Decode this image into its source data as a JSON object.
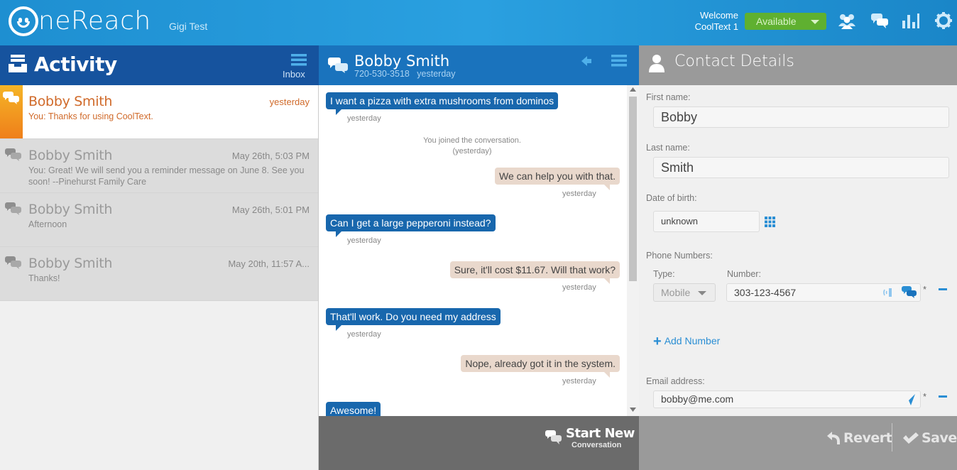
{
  "header": {
    "logo_text": "neReach",
    "account": "Gigi Test",
    "welcome_line1": "Welcome",
    "welcome_line2": "CoolText 1",
    "status": "Available",
    "icons": [
      "contacts-icon",
      "conversations-icon",
      "reports-icon",
      "settings-icon"
    ]
  },
  "activity": {
    "title": "Activity",
    "inbox_label": "Inbox",
    "items": [
      {
        "name": "Bobby Smith",
        "time": "yesterday",
        "message": "You: Thanks for using CoolText.",
        "active": true
      },
      {
        "name": "Bobby Smith",
        "time": "May 26th, 5:03 PM",
        "message": "You: Great! We will send you a reminder message on June 8. See you soon! --Pinehurst Family Care",
        "active": false
      },
      {
        "name": "Bobby Smith",
        "time": "May 26th, 5:01 PM",
        "message": "Afternoon",
        "active": false
      },
      {
        "name": "Bobby Smith",
        "time": "May 20th, 11:57 A...",
        "message": "Thanks!",
        "active": false
      }
    ]
  },
  "conversation": {
    "name": "Bobby Smith",
    "phone": "720-530-3518",
    "when": "yesterday",
    "messages": [
      {
        "dir": "in",
        "text": "I want a pizza with extra mushrooms from dominos",
        "stamp": "yesterday"
      },
      {
        "dir": "sys",
        "text": "You joined the conversation.",
        "stamp": "(yesterday)"
      },
      {
        "dir": "out",
        "text": "We can help you with that.",
        "stamp": "yesterday"
      },
      {
        "dir": "in",
        "text": "Can I get a large pepperoni instead?",
        "stamp": "yesterday"
      },
      {
        "dir": "out",
        "text": "Sure, it'll cost $11.67. Will that work?",
        "stamp": "yesterday"
      },
      {
        "dir": "in",
        "text": "That'll work. Do you need my address",
        "stamp": "yesterday"
      },
      {
        "dir": "out",
        "text": "Nope, already got it in the system.",
        "stamp": "yesterday"
      },
      {
        "dir": "in",
        "text": "Awesome!",
        "stamp": ""
      }
    ],
    "start_new": "Start New",
    "start_new_sub": "Conversation"
  },
  "contact": {
    "title": "Contact Details",
    "first_name_label": "First name:",
    "first_name": "Bobby",
    "last_name_label": "Last name:",
    "last_name": "Smith",
    "dob_label": "Date of birth:",
    "dob": "unknown",
    "phones_label": "Phone Numbers:",
    "type_label": "Type:",
    "number_label": "Number:",
    "phone_type": "Mobile",
    "phone_number": "303-123-4567",
    "required_mark": "*",
    "add_number": "Add Number",
    "email_label": "Email address:",
    "email": "bobby@me.com",
    "revert": "Revert",
    "save": "Save"
  }
}
